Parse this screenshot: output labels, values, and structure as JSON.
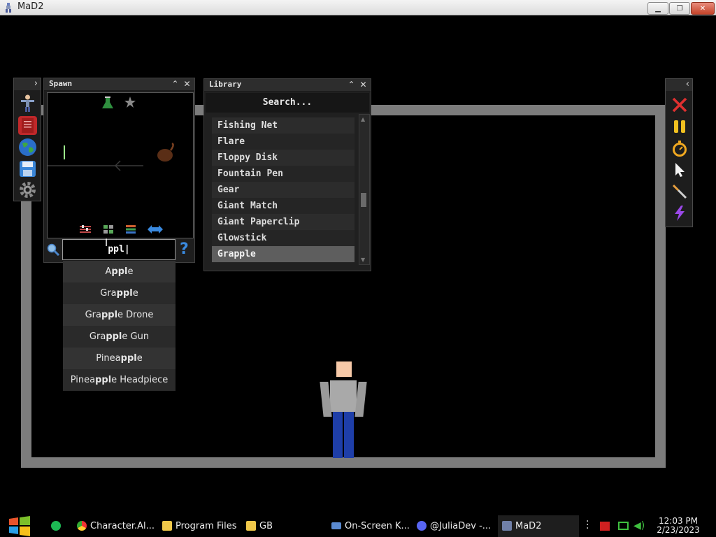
{
  "window": {
    "title": "MaD2",
    "minimize_icon": "minimize-icon",
    "restore_icon": "restore-icon",
    "close_icon": "close-icon"
  },
  "spawn_panel": {
    "title": "Spawn",
    "collapse_icon": "chevron-up-icon",
    "close_icon": "close-icon",
    "search_value": "ppl",
    "search_icon": "magnifier-icon",
    "help_icon": "question-icon",
    "toolbar_icons": [
      "filter-sliders-icon",
      "grid-view-icon",
      "list-view-icon",
      "swap-arrows-icon"
    ]
  },
  "suggestions": [
    {
      "before": "A",
      "match": "ppl",
      "after": "e"
    },
    {
      "before": "Gra",
      "match": "ppl",
      "after": "e"
    },
    {
      "before": "Gra",
      "match": "ppl",
      "after": "e Drone"
    },
    {
      "before": "Gra",
      "match": "ppl",
      "after": "e Gun"
    },
    {
      "before": "Pinea",
      "match": "ppl",
      "after": "e"
    },
    {
      "before": "Pinea",
      "match": "ppl",
      "after": "e Headpiece"
    }
  ],
  "library_panel": {
    "title": "Library",
    "search_placeholder": "Search...",
    "items": [
      "Fishing Net",
      "Flare",
      "Floppy Disk",
      "Fountain Pen",
      "Gear",
      "Giant Match",
      "Giant Paperclip",
      "Glowstick",
      "Grapple"
    ],
    "selected_index": 8,
    "scroll_fraction": 0.62
  },
  "left_rail": {
    "icons": [
      "character-icon",
      "book-icon",
      "globe-icon",
      "save-icon",
      "gear-icon"
    ],
    "expand_icon": "chevron-right-icon"
  },
  "right_toolbar": {
    "icons": [
      "delete-x-icon",
      "pause-icon",
      "stopwatch-icon",
      "pointer-icon",
      "knife-icon",
      "lightning-icon"
    ],
    "collapse_icon": "chevron-left-icon"
  },
  "taskbar": {
    "items": [
      {
        "label": "",
        "icon": "windows-start-icon"
      },
      {
        "label": "",
        "icon": "spotify-icon"
      },
      {
        "label": "Character.Al...",
        "icon": "chrome-icon"
      },
      {
        "label": "Program Files",
        "icon": "folder-icon"
      },
      {
        "label": "GB",
        "icon": "folder-icon"
      },
      {
        "label": "On-Screen K...",
        "icon": "keyboard-icon"
      },
      {
        "label": "@JuliaDev -...",
        "icon": "discord-icon"
      },
      {
        "label": "MaD2",
        "icon": "mad2-app-icon"
      }
    ],
    "tray_icons": [
      "more-icon",
      "flag-icon",
      "network-icon",
      "volume-icon"
    ],
    "time": "12:03 PM",
    "date": "2/23/2023"
  },
  "colors": {
    "arena_border": "#7c7c7c",
    "panel_bg": "#1e1e1e",
    "selected_row": "#5e5e5e",
    "accent_red": "#e03030",
    "accent_yellow": "#f0c020"
  }
}
